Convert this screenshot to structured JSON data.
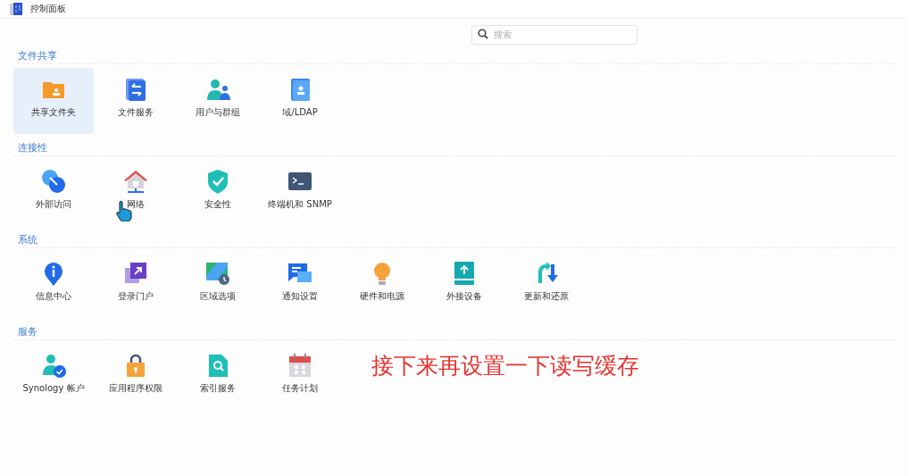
{
  "window": {
    "title": "控制面板"
  },
  "search": {
    "placeholder": "搜索"
  },
  "sections": [
    {
      "title": "文件共享",
      "items": [
        {
          "label": "共享文件夹",
          "kind": "folder",
          "selected": true
        },
        {
          "label": "文件服务",
          "kind": "transfer",
          "selected": false
        },
        {
          "label": "用户与群组",
          "kind": "users",
          "selected": false
        },
        {
          "label": "域/LDAP",
          "kind": "directory",
          "selected": false
        }
      ]
    },
    {
      "title": "连接性",
      "items": [
        {
          "label": "外部访问",
          "kind": "globe",
          "selected": false
        },
        {
          "label": "网络",
          "kind": "house",
          "selected": false
        },
        {
          "label": "安全性",
          "kind": "shield",
          "selected": false
        },
        {
          "label": "终端机和 SNMP",
          "kind": "terminal",
          "selected": false
        }
      ]
    },
    {
      "title": "系统",
      "items": [
        {
          "label": "信息中心",
          "kind": "info",
          "selected": false
        },
        {
          "label": "登录门户",
          "kind": "portal",
          "selected": false
        },
        {
          "label": "区域选项",
          "kind": "region",
          "selected": false
        },
        {
          "label": "通知设置",
          "kind": "message",
          "selected": false
        },
        {
          "label": "硬件和电源",
          "kind": "bulb",
          "selected": false
        },
        {
          "label": "外接设备",
          "kind": "device",
          "selected": false
        },
        {
          "label": "更新和还原",
          "kind": "update",
          "selected": false
        }
      ]
    },
    {
      "title": "服务",
      "items": [
        {
          "label": "Synology 帐户",
          "kind": "account",
          "selected": false
        },
        {
          "label": "应用程序权限",
          "kind": "lock",
          "selected": false
        },
        {
          "label": "索引服务",
          "kind": "index",
          "selected": false
        },
        {
          "label": "任务计划",
          "kind": "calendar",
          "selected": false
        }
      ]
    }
  ],
  "caption": "接下来再设置一下读写缓存"
}
